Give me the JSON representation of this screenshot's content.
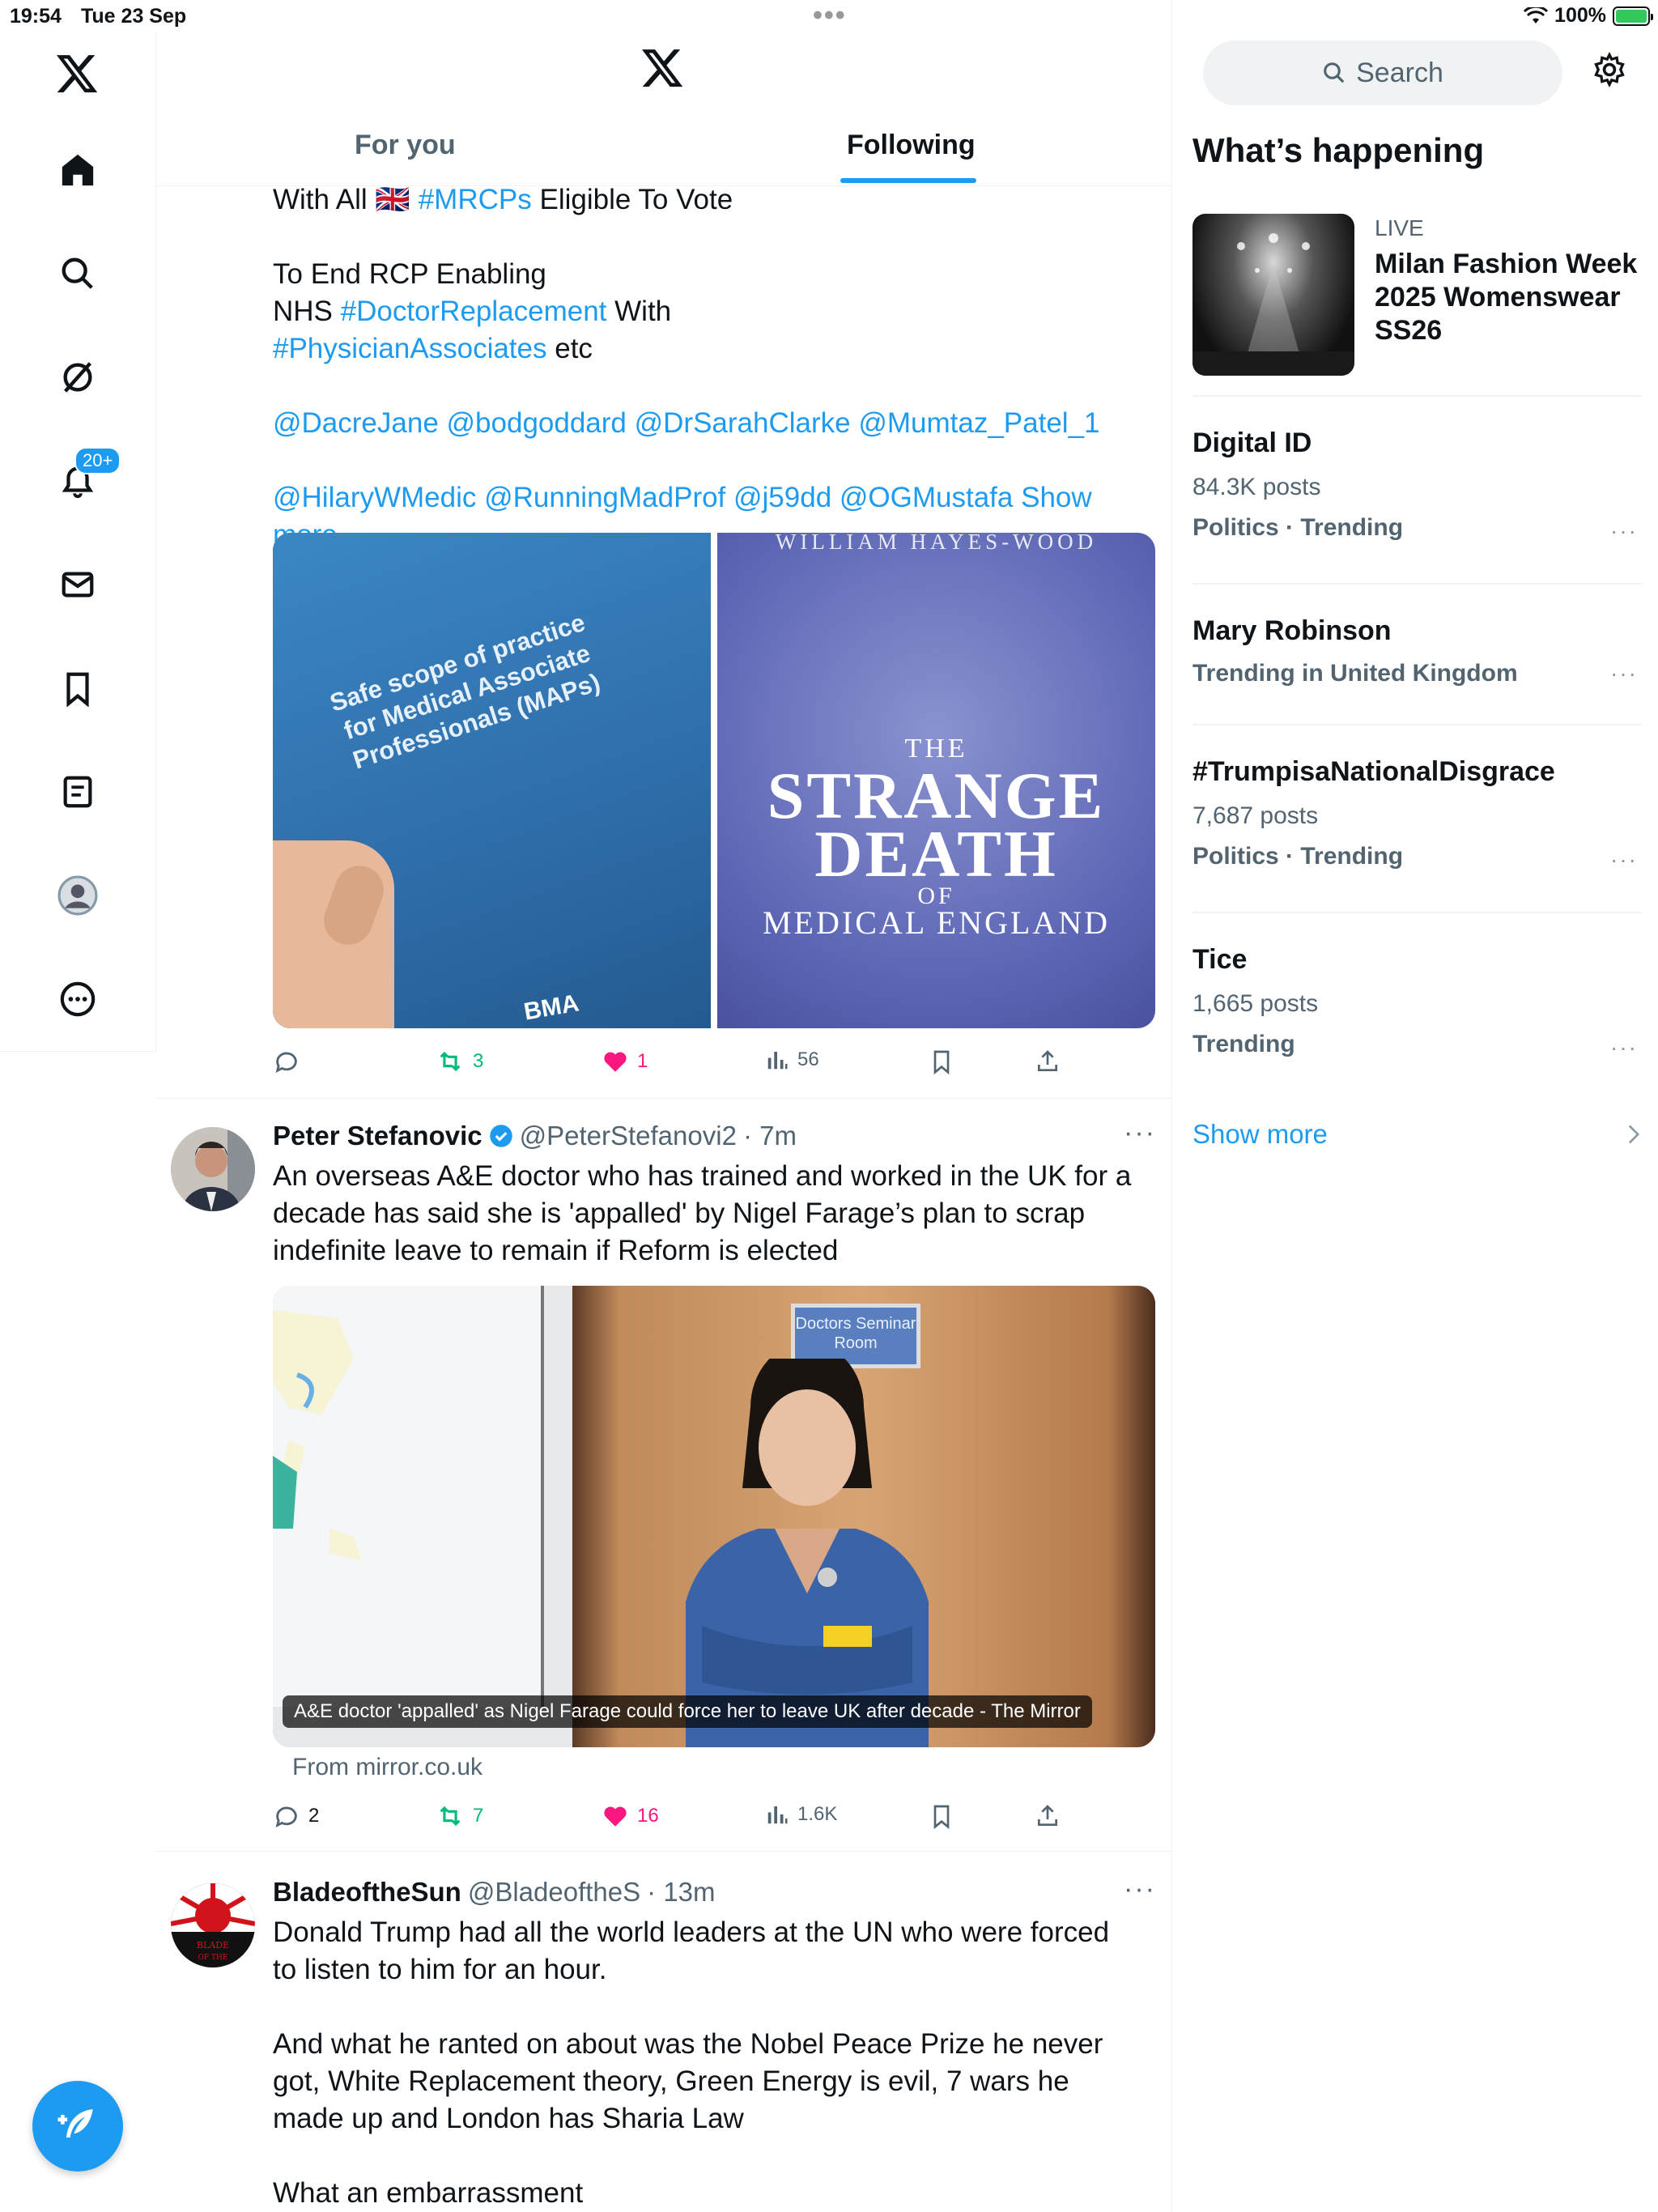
{
  "status_bar": {
    "time": "19:54",
    "date": "Tue 23 Sep",
    "battery": "100%"
  },
  "nav": {
    "notifications_badge": "20+"
  },
  "header": {
    "tabs": [
      "For you",
      "Following"
    ],
    "active_tab": "Following"
  },
  "post1": {
    "lines": {
      "l1_pre": "With All 🇬🇧 ",
      "l1_tag": "#MRCPs",
      "l1_post": " Eligible To Vote",
      "l2": "To End RCP Enabling",
      "l3_pre": "NHS ",
      "l3_tag": "#DoctorReplacement",
      "l3_post": " With",
      "l4_tag": "#PhysicianAssociates",
      "l4_post": " etc",
      "l5": "@DacreJane @bodgoddard @DrSarahClarke @Mumtaz_Patel_1",
      "l6": "@HilaryWMedic @RunningMadProf @j59dd @OGMustafa",
      "show_more": "Show more"
    },
    "image_left": {
      "text": "Safe scope of practice for Medical Associate Professionals (MAPs)",
      "logo": "BMA"
    },
    "image_right": {
      "author": "WILLIAM HAYES-WOOD",
      "the": "THE",
      "title1": "STRANGE",
      "title2": "DEATH",
      "of": "OF",
      "title3": "MEDICAL ENGLAND"
    },
    "stats": {
      "replies": "",
      "reposts": "3",
      "likes": "1",
      "views": "56"
    }
  },
  "post2": {
    "name": "Peter Stefanovic",
    "handle": "@PeterStefanovi2",
    "time": "· 7m",
    "text": "An overseas A&E doctor who has trained and worked in the UK for a decade has said she is 'appalled' by Nigel Farage’s plan to scrap indefinite leave to remain if Reform is elected",
    "card_caption": "A&E doctor 'appalled' as Nigel Farage could force her to leave UK after decade - The Mirror",
    "door_sign": "Doctors Seminar Room",
    "card_source": "From mirror.co.uk",
    "stats": {
      "replies": "2",
      "reposts": "7",
      "likes": "16",
      "views": "1.6K"
    }
  },
  "post3": {
    "name": "BladeoftheSun",
    "handle": "@BladeoftheS",
    "time": "· 13m",
    "p1": "Donald Trump had all the world leaders at the UN who were forced to listen to him for an hour.",
    "p2": "And what he ranted on about was the Nobel Peace Prize he never got, White Replacement theory, Green Energy is evil, 7 wars he made up and London has Sharia Law",
    "p3": "What an embarrassment",
    "avatar_text": "BLADE OF THE SUN"
  },
  "sidebar": {
    "search_placeholder": "Search",
    "title": "What’s happening",
    "featured": {
      "label": "LIVE",
      "title": "Milan Fashion Week 2025 Womenswear SS26"
    },
    "trends": [
      {
        "name": "Digital ID",
        "count": "84.3K posts",
        "context": "Politics · Trending"
      },
      {
        "name": "Mary Robinson",
        "count": "",
        "context": "Trending in United Kingdom"
      },
      {
        "name": "#TrumpisaNationalDisgrace",
        "count": "7,687 posts",
        "context": "Politics · Trending"
      },
      {
        "name": "Tice",
        "count": "1,665 posts",
        "context": "Trending"
      }
    ],
    "show_more": "Show more"
  },
  "colors": {
    "accent": "#1d9bf0",
    "like": "#f91880",
    "repost": "#00ba7c",
    "muted": "#536471"
  }
}
